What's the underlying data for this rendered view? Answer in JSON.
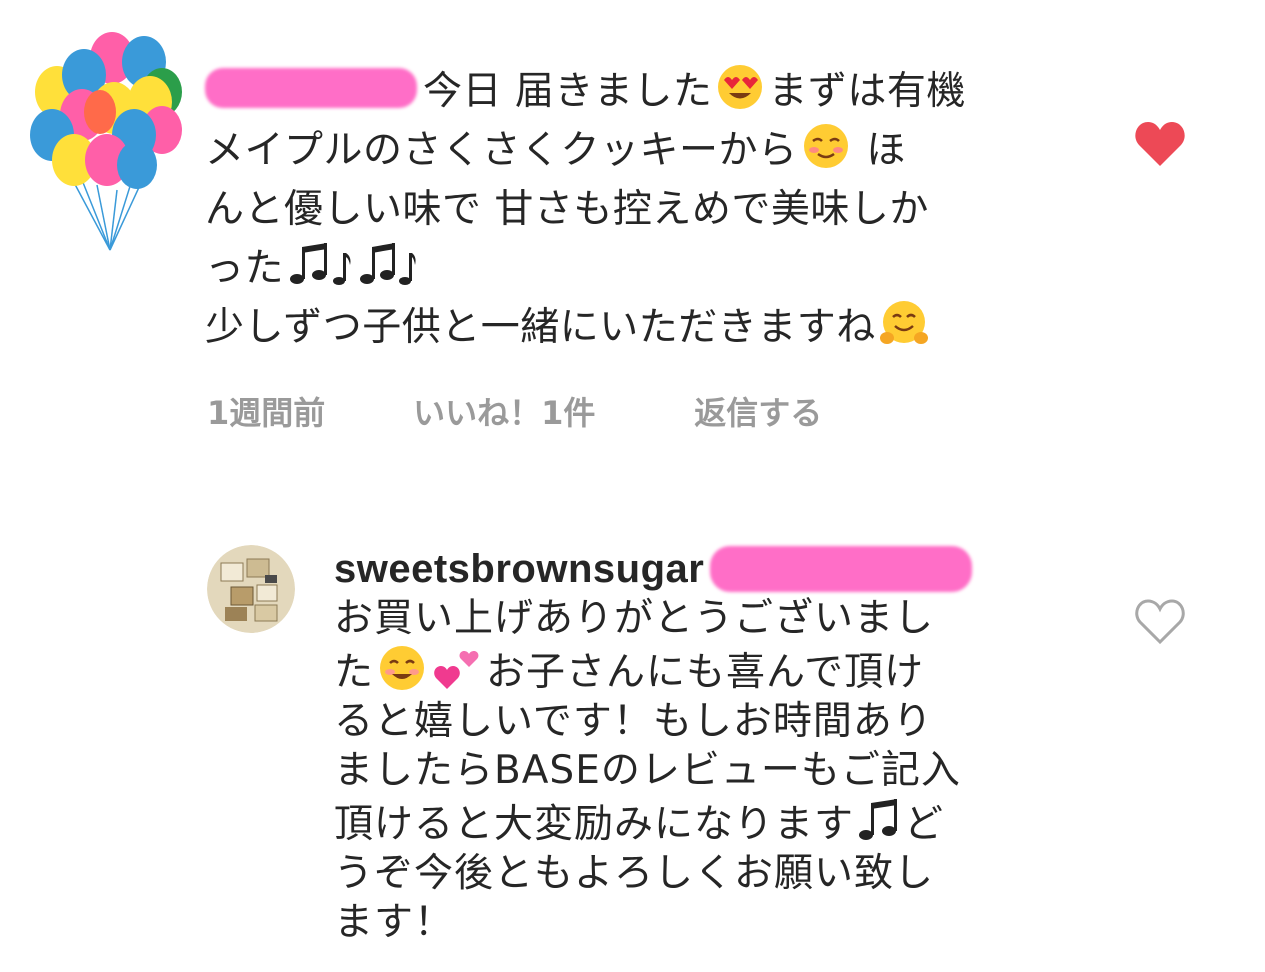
{
  "comment": {
    "lines": [
      "今日 届きました",
      "まずは有機",
      "メイプルのさくさくクッキーから",
      " ほ",
      "んと優しい味で 甘さも控えめで美味しか",
      "った",
      "少しずつ子供と一緒にいただきますね"
    ],
    "time": "1週間前",
    "likes": "いいね！1件",
    "reply": "返信する",
    "liked": true
  },
  "reply": {
    "username": "sweetsbrownsugar",
    "lines": [
      "お買い上げありがとうございまし",
      "た",
      "お子さんにも喜んで頂け",
      "ると嬉しいです！もしお時間あり",
      "ましたらBASEのレビューもご記入",
      "頂けると大変励みになります",
      "ど",
      "うぞ今後ともよろしくお願い致し",
      "ます！"
    ],
    "liked": false
  },
  "colors": {
    "heart_filled": "#ed4956",
    "heart_outline": "#a8a8a8",
    "meta_text": "#9a9a9a",
    "redaction": "#ff6ec7"
  },
  "icons": [
    "balloons-avatar-icon",
    "heart-eyes-emoji-icon",
    "smiling-blush-emoji-icon",
    "music-notes-icon",
    "hugging-emoji-icon",
    "heart-icon",
    "smile-emoji-icon",
    "two-hearts-emoji-icon",
    "music-note-icon",
    "heart-outline-icon",
    "shop-avatar-icon"
  ]
}
